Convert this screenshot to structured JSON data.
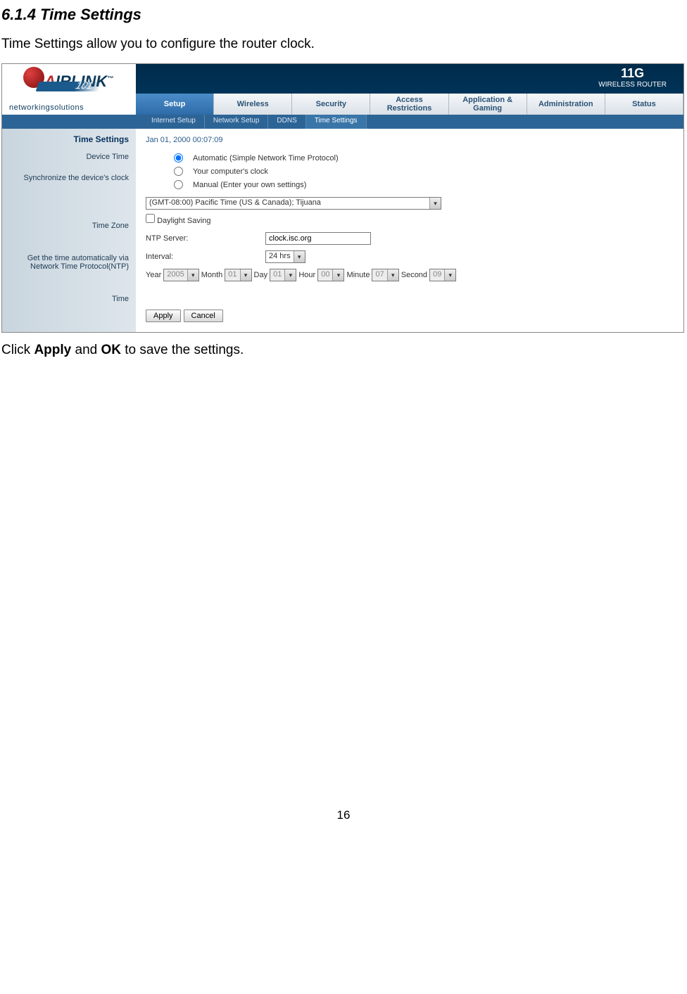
{
  "doc": {
    "heading": "6.1.4 Time Settings",
    "intro": "Time Settings allow you to configure the router clock.",
    "outro_prefix": "Click ",
    "outro_bold1": "Apply",
    "outro_mid": " and ",
    "outro_bold2": "OK",
    "outro_suffix": " to save the settings.",
    "page_number": "16"
  },
  "router": {
    "brand_letters": "IRLINK",
    "brand_num": "101",
    "brand_tag": "networkingsolutions",
    "badge_top": "11G",
    "badge_mid": "WIRELESS",
    "badge_bot": "ROUTER",
    "tabs": {
      "setup": "Setup",
      "wireless": "Wireless",
      "security": "Security",
      "access": "Access\nRestrictions",
      "apps": "Application &\nGaming",
      "admin": "Administration",
      "status": "Status"
    },
    "subtabs": {
      "internet": "Internet Setup",
      "network": "Network Setup",
      "ddns": "DDNS",
      "time": "Time Settings"
    },
    "left": {
      "head": "Time Settings",
      "device_time": "Device Time",
      "sync": "Synchronize the device's clock",
      "tz": "Time Zone",
      "ntp1": "Get the time automatically via",
      "ntp2": "Network Time Protocol(NTP)",
      "time": "Time"
    },
    "content": {
      "device_time_value": "Jan 01, 2000 00:07:09",
      "sync_opt1": "Automatic (Simple Network Time Protocol)",
      "sync_opt2": "Your computer's clock",
      "sync_opt3": "Manual (Enter your own settings)",
      "tz_value": "(GMT-08:00) Pacific Time (US & Canada); Tijuana",
      "daylight": "Daylight Saving",
      "ntp_label": "NTP Server:",
      "ntp_value": "clock.isc.org",
      "interval_label": "Interval:",
      "interval_value": "24 hrs",
      "year_label": "Year",
      "year_value": "2005",
      "month_label": "Month",
      "month_value": "01",
      "day_label": "Day",
      "day_value": "01",
      "hour_label": "Hour",
      "hour_value": "00",
      "minute_label": "Minute",
      "minute_value": "07",
      "second_label": "Second",
      "second_value": "09",
      "apply": "Apply",
      "cancel": "Cancel"
    }
  }
}
